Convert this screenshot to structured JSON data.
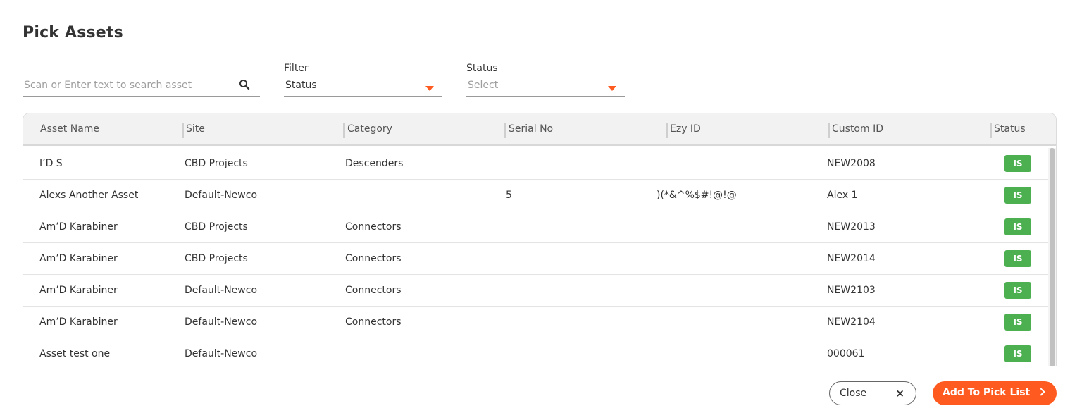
{
  "dialog": {
    "title": "Pick Assets"
  },
  "search": {
    "placeholder": "Scan or Enter text to search asset",
    "icon": "search-icon"
  },
  "filter": {
    "label": "Filter",
    "value": "Status"
  },
  "status_select": {
    "label": "Status",
    "placeholder": "Select"
  },
  "table": {
    "columns": [
      "Asset Name",
      "Site",
      "Category",
      "Serial No",
      "Ezy ID",
      "Custom ID",
      "Status"
    ],
    "rows": [
      {
        "name": "I’D S",
        "site": "CBD Projects",
        "category": "Descenders",
        "serial": "",
        "ezy": "",
        "custom": "NEW2008",
        "status": "IS"
      },
      {
        "name": "Alexs Another Asset",
        "site": "Default-Newco",
        "category": "",
        "serial": "5",
        "ezy": ")(*&^%$#!@!@",
        "custom": "Alex 1",
        "status": "IS"
      },
      {
        "name": "Am’D Karabiner",
        "site": "CBD Projects",
        "category": "Connectors",
        "serial": "",
        "ezy": "",
        "custom": "NEW2013",
        "status": "IS"
      },
      {
        "name": "Am’D Karabiner",
        "site": "CBD Projects",
        "category": "Connectors",
        "serial": "",
        "ezy": "",
        "custom": "NEW2014",
        "status": "IS"
      },
      {
        "name": "Am’D Karabiner",
        "site": "Default-Newco",
        "category": "Connectors",
        "serial": "",
        "ezy": "",
        "custom": "NEW2103",
        "status": "IS"
      },
      {
        "name": "Am’D Karabiner",
        "site": "Default-Newco",
        "category": "Connectors",
        "serial": "",
        "ezy": "",
        "custom": "NEW2104",
        "status": "IS"
      },
      {
        "name": "Asset test one",
        "site": "Default-Newco",
        "category": "",
        "serial": "",
        "ezy": "",
        "custom": "000061",
        "status": "IS"
      }
    ]
  },
  "footer": {
    "close_label": "Close",
    "close_icon": "close-icon",
    "add_label": "Add To Pick List",
    "add_icon": "chevron-right-icon"
  },
  "colors": {
    "accent": "#ff5a1f",
    "status_green": "#4caf50"
  }
}
